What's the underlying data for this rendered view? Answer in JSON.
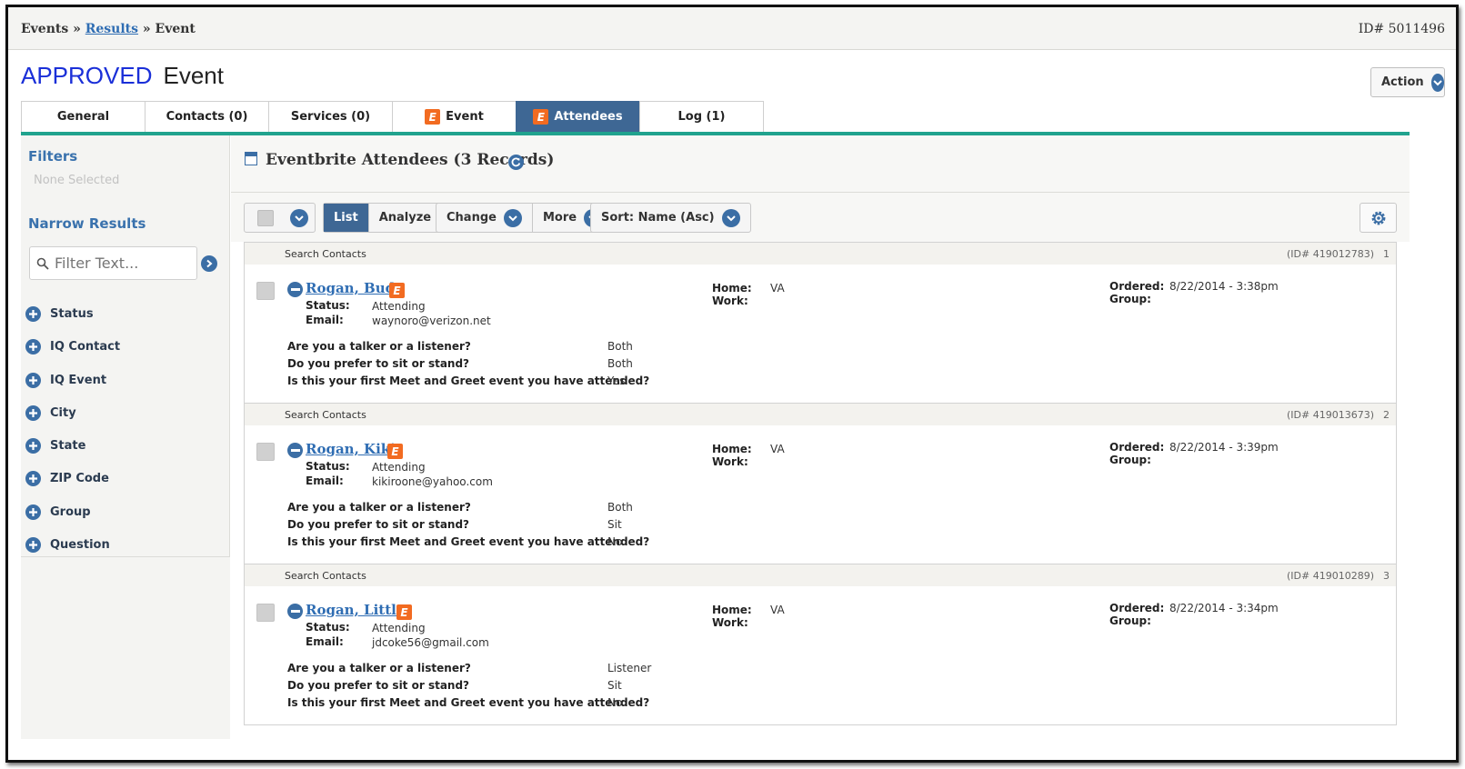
{
  "breadcrumb": {
    "part1": "Events",
    "sep1": " » ",
    "link": "Results",
    "sep2": " » ",
    "part3": "Event"
  },
  "top_id": "ID# 5011496",
  "title": {
    "status": "APPROVED",
    "word": "Event"
  },
  "action_label": "Action",
  "tabs": [
    {
      "label": "General"
    },
    {
      "label": "Contacts (0)"
    },
    {
      "label": "Services (0)"
    },
    {
      "label": "Event",
      "badge": "E"
    },
    {
      "label": "Attendees",
      "badge": "E",
      "active": true
    },
    {
      "label": "Log (1)"
    }
  ],
  "sidebar": {
    "filters_heading": "Filters",
    "filters_none": "None Selected",
    "narrow_heading": "Narrow Results",
    "filter_placeholder": "Filter Text...",
    "items": [
      "Status",
      "IQ Contact",
      "IQ Event",
      "City",
      "State",
      "ZIP Code",
      "Group",
      "Question"
    ]
  },
  "main": {
    "heading": "Eventbrite Attendees (3 Records)",
    "toolbar": {
      "list": "List",
      "analyze": "Analyze",
      "change": "Change",
      "more": "More",
      "sort": "Sort: Name (Asc)"
    }
  },
  "labels": {
    "search_contacts": "Search Contacts",
    "status": "Status:",
    "email": "Email:",
    "home": "Home:",
    "work": "Work:",
    "ordered": "Ordered:",
    "group": "Group:",
    "q1": "Are you a talker or a listener?",
    "q2": "Do you prefer to sit or stand?",
    "q3": "Is this your first Meet and Greet event you have attended?",
    "badge": "E"
  },
  "records": [
    {
      "id": "(ID# 419012783)",
      "num": "1",
      "name": "Rogan, Bud",
      "status": "Attending",
      "email": "waynoro@verizon.net",
      "home": "VA",
      "ordered": "8/22/2014 - 3:38pm",
      "a1": "Both",
      "a2": "Both",
      "a3": "Yes"
    },
    {
      "id": "(ID# 419013673)",
      "num": "2",
      "name": "Rogan, Kiki",
      "status": "Attending",
      "email": "kikiroone@yahoo.com",
      "home": "VA",
      "ordered": "8/22/2014 - 3:39pm",
      "a1": "Both",
      "a2": "Sit",
      "a3": "No"
    },
    {
      "id": "(ID# 419010289)",
      "num": "3",
      "name": "Rogan, Little",
      "status": "Attending",
      "email": "jdcoke56@gmail.com",
      "home": "VA",
      "ordered": "8/22/2014 - 3:34pm",
      "a1": "Listener",
      "a2": "Sit",
      "a3": "No"
    }
  ],
  "colors": {
    "accent": "#3e6794",
    "teal": "#20a38e",
    "approved": "#1a2fd8",
    "eventbrite": "#f26b21"
  }
}
